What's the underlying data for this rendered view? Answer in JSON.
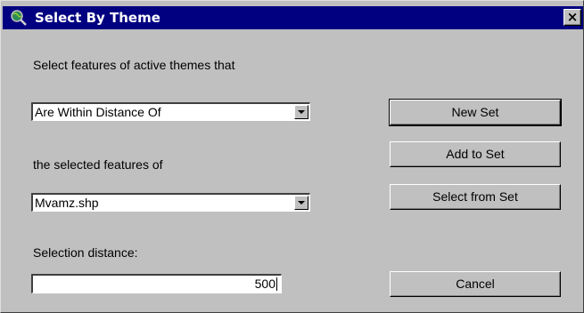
{
  "window": {
    "title": "Select By Theme",
    "close_label": "×"
  },
  "form": {
    "prompt_label": "Select features of active themes that",
    "relation_value": "Are Within Distance Of",
    "of_label": "the selected features of",
    "theme_value": "Mvamz.shp",
    "distance_label": "Selection distance:",
    "distance_value": "500"
  },
  "buttons": {
    "new_set": "New Set",
    "add_to_set": "Add to Set",
    "select_from_set": "Select from Set",
    "cancel": "Cancel"
  }
}
